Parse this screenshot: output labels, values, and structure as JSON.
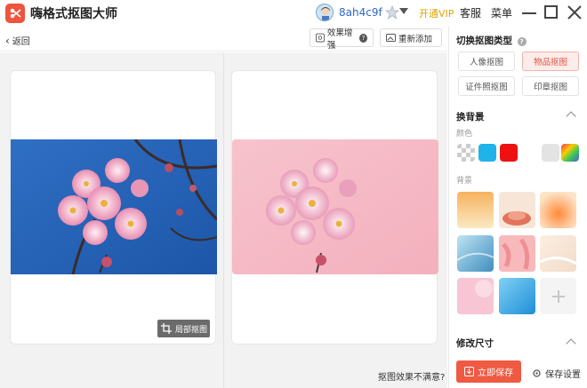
{
  "app": {
    "title": "嗨格式抠图大师",
    "username": "8ah4c9f",
    "open_vip": "开通VIP",
    "service": "客服",
    "menu": "菜单"
  },
  "toolbar": {
    "back": "返回",
    "enhance": "效果增强",
    "enhance_help": "?",
    "readd": "重新添加"
  },
  "canvas": {
    "local_cut": "局部抠图",
    "dissatisfied": "抠图效果不满意?"
  },
  "panel": {
    "cut_type_title": "切换抠图类型",
    "cut_types": [
      "人像抠图",
      "物品抠图",
      "证件照抠图",
      "印章抠图"
    ],
    "active_type": "物品抠图",
    "change_bg_title": "换背景",
    "color_label": "颜色",
    "colors": [
      "transparent",
      "#1fb3ea",
      "#ee1111",
      "#ffffff",
      "#e3e3e3",
      "rainbow"
    ],
    "background_label": "背景",
    "resize_title": "修改尺寸",
    "save_now": "立即保存",
    "save_settings": "保存设置"
  }
}
